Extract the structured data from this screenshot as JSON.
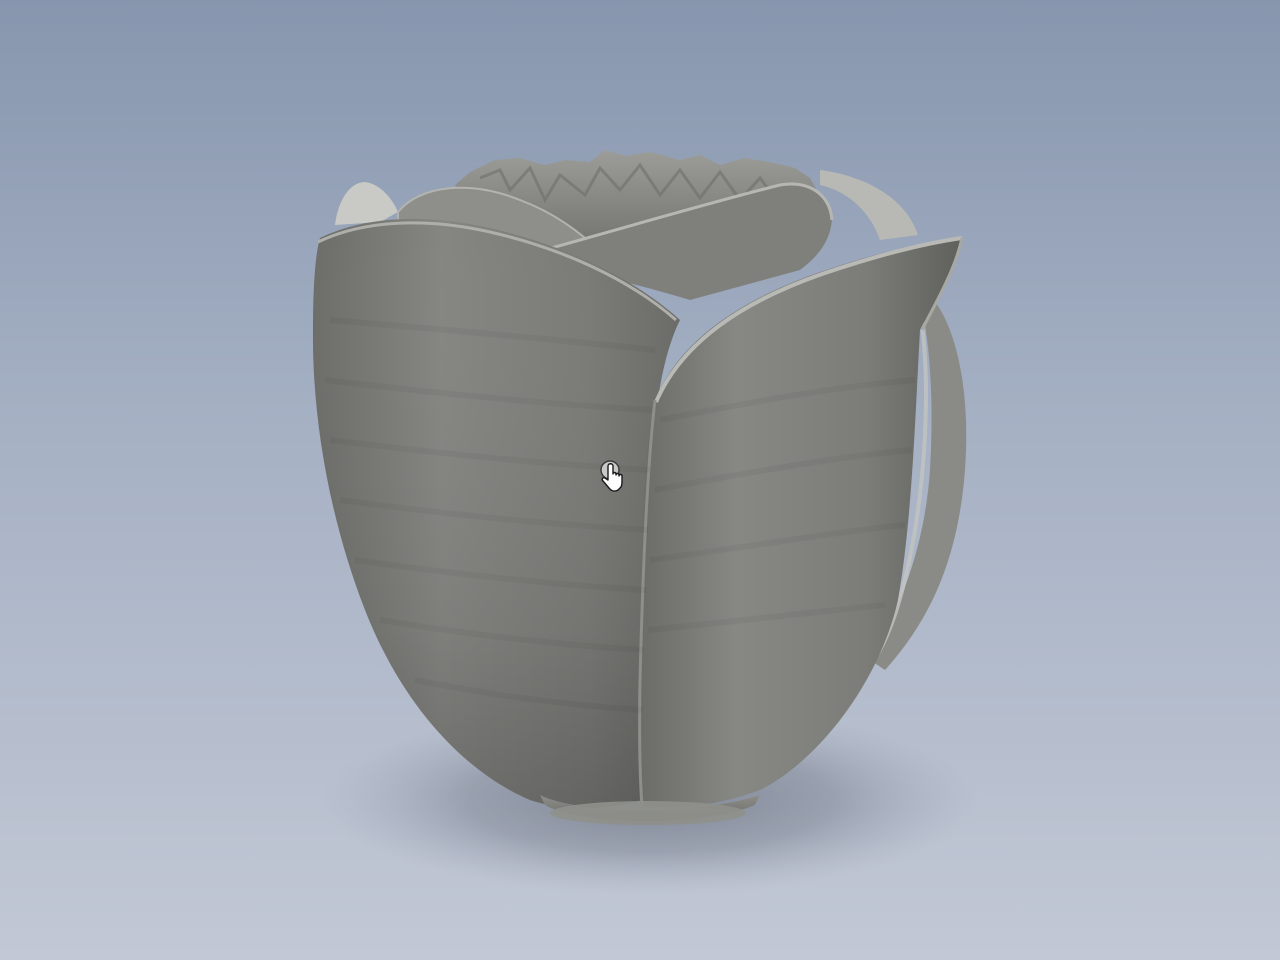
{
  "viewport": {
    "background_top": "#8796ae",
    "background_bottom": "#c2c8d5"
  },
  "model": {
    "name": "rose-flower-model",
    "surface_color": "#7b7c78",
    "highlight_color": "#a9aaa5",
    "shadow_color": "#5a5b58"
  },
  "cursor": {
    "icon": "hand-pointer-icon"
  }
}
